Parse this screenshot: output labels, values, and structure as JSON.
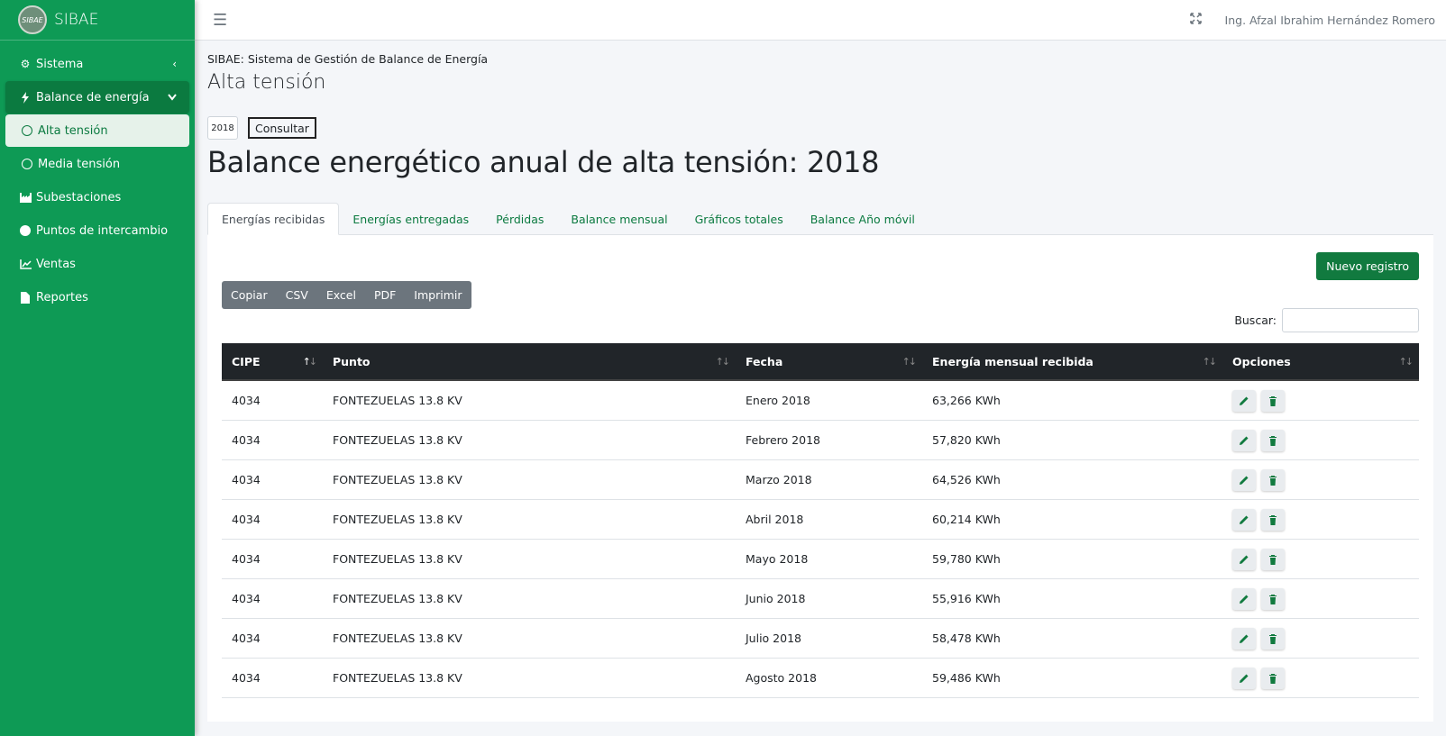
{
  "brand": {
    "name": "SIBAE",
    "logo_text": "SIBAE"
  },
  "sidebar": {
    "items": [
      {
        "label": "Sistema",
        "icon": "gear-icon"
      },
      {
        "label": "Balance de energía",
        "icon": "bolt-icon"
      },
      {
        "label": "Alta tensión",
        "icon": "circle-icon"
      },
      {
        "label": "Media tensión",
        "icon": "circle-icon"
      },
      {
        "label": "Subestaciones",
        "icon": "industry-icon"
      },
      {
        "label": "Puntos de intercambio",
        "icon": "dot-icon"
      },
      {
        "label": "Ventas",
        "icon": "chart-line-icon"
      },
      {
        "label": "Reportes",
        "icon": "file-icon"
      }
    ]
  },
  "topbar": {
    "user": "Ing. Afzal Ibrahim Hernández Romero"
  },
  "breadcrumb": "SIBAE: Sistema de Gestión de Balance de Energía",
  "page_title": "Alta tensión",
  "year_value": "2018",
  "consultar_label": "Consultar",
  "big_title": "Balance energético anual de alta tensión: 2018",
  "tabs": [
    "Energías recibidas",
    "Energías entregadas",
    "Pérdidas",
    "Balance mensual",
    "Gráficos totales",
    "Balance Año móvil"
  ],
  "new_button": "Nuevo registro",
  "export_buttons": [
    "Copiar",
    "CSV",
    "Excel",
    "PDF",
    "Imprimir"
  ],
  "search_label": "Buscar:",
  "table": {
    "headers": [
      "CIPE",
      "Punto",
      "Fecha",
      "Energía mensual recibida",
      "Opciones"
    ],
    "rows": [
      [
        "4034",
        "FONTEZUELAS 13.8 KV",
        "Enero 2018",
        "63,266 KWh"
      ],
      [
        "4034",
        "FONTEZUELAS 13.8 KV",
        "Febrero 2018",
        "57,820 KWh"
      ],
      [
        "4034",
        "FONTEZUELAS 13.8 KV",
        "Marzo 2018",
        "64,526 KWh"
      ],
      [
        "4034",
        "FONTEZUELAS 13.8 KV",
        "Abril 2018",
        "60,214 KWh"
      ],
      [
        "4034",
        "FONTEZUELAS 13.8 KV",
        "Mayo 2018",
        "59,780 KWh"
      ],
      [
        "4034",
        "FONTEZUELAS 13.8 KV",
        "Junio 2018",
        "55,916 KWh"
      ],
      [
        "4034",
        "FONTEZUELAS 13.8 KV",
        "Julio 2018",
        "58,478 KWh"
      ],
      [
        "4034",
        "FONTEZUELAS 13.8 KV",
        "Agosto 2018",
        "59,486 KWh"
      ]
    ]
  },
  "colors": {
    "sidebar": "#0e9a55",
    "accent": "#117a3f",
    "table_header": "#212529"
  }
}
